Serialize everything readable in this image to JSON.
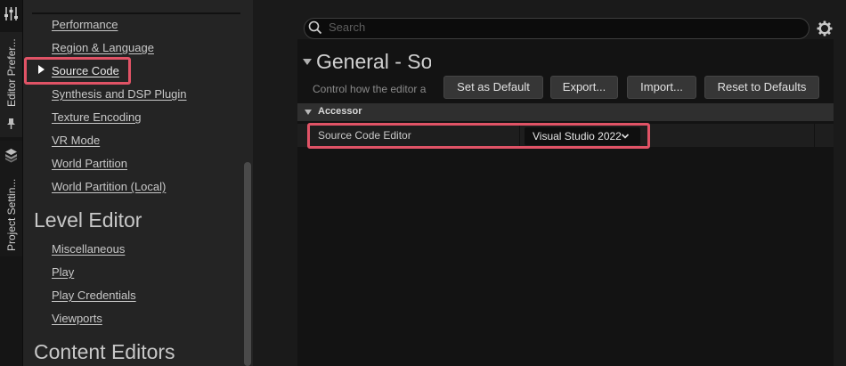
{
  "vertical_tabs": {
    "editor_prefs": "Editor Prefer...",
    "project_settings": "Project Settin..."
  },
  "nav": {
    "general_items": [
      "Performance",
      "Region & Language",
      "Source Code",
      "Synthesis and DSP Plugin",
      "Texture Encoding",
      "VR Mode",
      "World Partition",
      "World Partition (Local)"
    ],
    "selected_item": "Source Code",
    "level_editor": {
      "heading": "Level Editor",
      "items": [
        "Miscellaneous",
        "Play",
        "Play Credentials",
        "Viewports"
      ]
    },
    "content_editors": {
      "heading": "Content Editors"
    }
  },
  "search": {
    "placeholder": "Search"
  },
  "details": {
    "title": "General - So",
    "description": "Control how the editor a",
    "buttons": {
      "set_default": "Set as Default",
      "export": "Export...",
      "import": "Import...",
      "reset": "Reset to Defaults"
    },
    "category": "Accessor",
    "property": {
      "label": "Source Code Editor",
      "value": "Visual Studio 2022"
    }
  },
  "colors": {
    "highlight": "#e05366",
    "panel": "#242424",
    "background": "#1a1a1a"
  },
  "icons": [
    "sliders-icon",
    "pin-icon",
    "cube-stack-icon",
    "search-icon",
    "gear-icon",
    "chevron-down-icon"
  ]
}
